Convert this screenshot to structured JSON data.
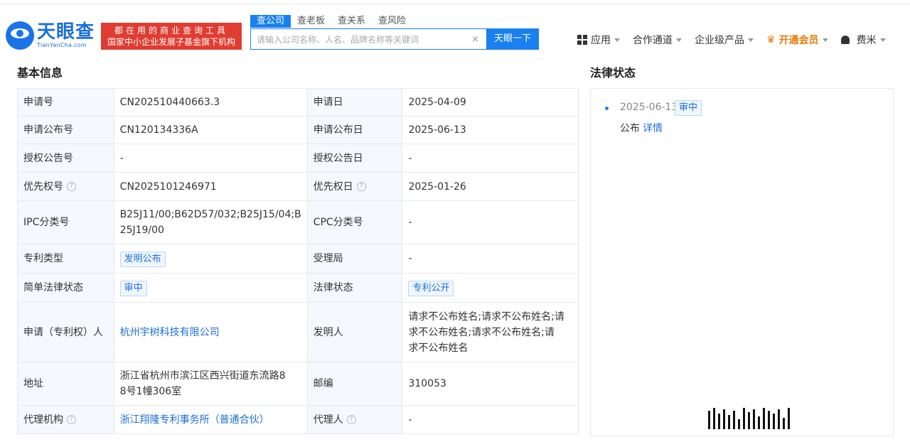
{
  "header": {
    "logo_cn": "天眼查",
    "logo_en": "TianYanCha.com",
    "slogan_line1": "都在用的商业查询工具",
    "slogan_line2": "国家中小企业发展子基金旗下机构",
    "tabs": [
      "查公司",
      "查老板",
      "查关系",
      "查风险"
    ],
    "search_placeholder": "请输入公司名称、人名、品牌名称等关键词",
    "search_clear": "×",
    "search_button": "天眼一下",
    "nav": {
      "apps": "应用",
      "partners": "合作通道",
      "enterprise": "企业级产品",
      "vip": "开通会员",
      "user": "费米"
    }
  },
  "basic_info": {
    "title": "基本信息",
    "rows": [
      {
        "l1": "申请号",
        "v1": "CN202510440663.3",
        "l2": "申请日",
        "v2": "2025-04-09"
      },
      {
        "l1": "申请公布号",
        "v1": "CN120134336A",
        "l2": "申请公布日",
        "v2": "2025-06-13"
      },
      {
        "l1": "授权公告号",
        "v1": "-",
        "l2": "授权公告日",
        "v2": "-"
      },
      {
        "l1": "优先权号",
        "v1": "CN2025101246971",
        "l2": "优先权日",
        "v2": "2025-01-26"
      },
      {
        "l1": "IPC分类号",
        "v1a": "B25J11/00;B62D57/032;B25J15/04;B",
        "v1b": "25J19/00",
        "l2": "CPC分类号",
        "v2": "-"
      },
      {
        "l1": "专利类型",
        "v1": "发明公布",
        "l2": "受理局",
        "v2": "-"
      },
      {
        "l1": "简单法律状态",
        "v1": "审中",
        "l2": "法律状态",
        "v2": "专利公开"
      },
      {
        "l1": "申请（专利权）人",
        "v1": "杭州宇树科技有限公司",
        "l2": "发明人",
        "v2a": "请求不公布姓名;请求不公布姓名;请",
        "v2b": "求不公布姓名;请求不公布姓名;请",
        "v2c": "求不公布姓名"
      },
      {
        "l1": "地址",
        "v1a": "浙江省杭州市滨江区西兴街道东流路8",
        "v1b": "8号1幢306室",
        "l2": "邮编",
        "v2": "310053"
      },
      {
        "l1": "代理机构",
        "v1": "浙江翔隆专利事务所（普通合伙）",
        "l2": "代理人",
        "v2": "-"
      }
    ]
  },
  "legal_status": {
    "title": "法律状态",
    "date": "2025-06-13",
    "tag": "审中",
    "event": "公布",
    "detail_link": "详情"
  },
  "help_icon": "?",
  "colors": {
    "brand": "#1a7ff0",
    "slogan_bg": "#e03c31",
    "vip": "#e57b09"
  }
}
